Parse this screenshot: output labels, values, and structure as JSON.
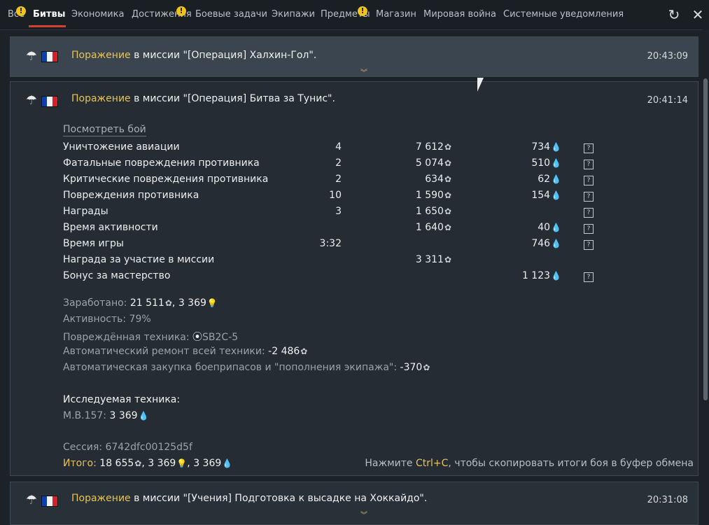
{
  "tabs": [
    {
      "label": "Все",
      "warn": true
    },
    {
      "label": "Битвы",
      "active": true
    },
    {
      "label": "Экономика"
    },
    {
      "label": "Достижения",
      "warn": true
    },
    {
      "label": "Боевые задачи"
    },
    {
      "label": "Экипажи"
    },
    {
      "label": "Предметы",
      "warn": true
    },
    {
      "label": "Магазин"
    },
    {
      "label": "Мировая война"
    },
    {
      "label": "Системные уведомления"
    }
  ],
  "warn_glyph": "!",
  "icons": {
    "refresh": "refresh-icon",
    "close": "close-icon",
    "parachute": "parachute-icon",
    "flag": "france-flag-icon",
    "silver": "silver-lions-icon",
    "rp": "research-points-icon",
    "gold_rp": "free-research-points-icon",
    "help": "help-icon",
    "chevron": "chevron-down-icon"
  },
  "colors": {
    "accent": "#d0412f",
    "defeat": "#e6c35a",
    "rp": "#7aa7d8",
    "gold": "#d9e45a"
  },
  "glyphs": {
    "silver": "✿",
    "rp": "💧",
    "gold": "💡",
    "help": "?",
    "refresh": "↻",
    "close": "✕",
    "parachute": "☂",
    "chevron": "︾",
    "target": "⦿"
  },
  "battles": [
    {
      "result": "Поражение",
      "text": " в миссии \"[Операция] Халхин-Гол\".",
      "time": "20:43:09"
    },
    {
      "result": "Поражение",
      "text": " в миссии \"[Операция] Битва за Тунис\".",
      "time": "20:41:14"
    },
    {
      "result": "Поражение",
      "text": " в миссии \"[Учения] Подготовка к высадке на Хоккайдо\".",
      "time": "20:31:08"
    }
  ],
  "detail": {
    "view_battle": "Посмотреть бой",
    "rows": [
      {
        "label": "Уничтожение авиации",
        "count": "4",
        "silver": "7 612",
        "rp": "734",
        "help": true
      },
      {
        "label": "Фатальные повреждения противника",
        "count": "2",
        "silver": "5 074",
        "rp": "510",
        "help": true
      },
      {
        "label": "Критические повреждения противника",
        "count": "2",
        "silver": "634",
        "rp": "62",
        "help": true
      },
      {
        "label": "Повреждения противника",
        "count": "10",
        "silver": "1 590",
        "rp": "154",
        "help": true
      },
      {
        "label": "Награды",
        "count": "3",
        "silver": "1 650",
        "rp": "",
        "help": true
      },
      {
        "label": "Время активности",
        "count": "",
        "silver": "1 640",
        "rp": "40",
        "help": true
      },
      {
        "label": "Время игры",
        "count": "3:32",
        "silver": "",
        "rp": "746",
        "help": true
      },
      {
        "label": "Награда за участие в миссии",
        "count": "",
        "silver": "3 311",
        "rp": "",
        "help": false
      },
      {
        "label": "Бонус за мастерство",
        "count": "",
        "silver": "",
        "rp": "1 123",
        "help": true
      }
    ],
    "earned_label": "Заработано: ",
    "earned_silver": "21 511",
    "earned_sep": ", ",
    "earned_gold": "3 369",
    "activity_label": "Активность: ",
    "activity_value": "79%",
    "damaged_label": "Повреждённая техника: ",
    "damaged_value": "SB2C-5",
    "repair_label": "Автоматический ремонт всей техники: ",
    "repair_value": "-2 486",
    "purchase_label": "Автоматическая закупка боеприпасов и \"пополнения экипажа\": ",
    "purchase_value": "-370",
    "research_title": "Исследуемая техника:",
    "research_vehicle": "M.B.157: ",
    "research_value": "3 369",
    "session_label": "Сессия: ",
    "session_value": "6742dfc00125d5f",
    "total_label": "Итого:",
    "total_silver": " 18 655",
    "total_gold": "3 369",
    "total_rp": "3 369",
    "hint_pre": "Нажмите ",
    "hint_key": "Ctrl+C",
    "hint_post": ", чтобы скопировать итоги боя в буфер обмена"
  }
}
